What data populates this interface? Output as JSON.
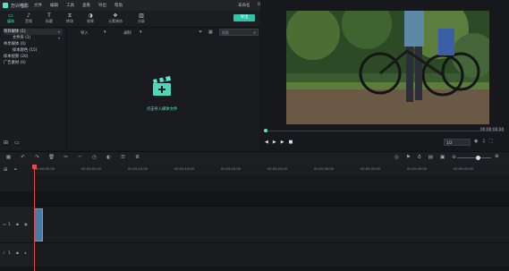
{
  "app": {
    "name": "万兴喵影",
    "project_name": "未命名",
    "timecode": "00:00:00:00"
  },
  "menu": [
    "文件",
    "编辑",
    "工具",
    "查看",
    "导出",
    "帮助"
  ],
  "toolbar": {
    "tabs": [
      {
        "label": "媒体",
        "icon": "folder-icon"
      },
      {
        "label": "音频",
        "icon": "music-icon"
      },
      {
        "label": "标题",
        "icon": "text-icon"
      },
      {
        "label": "转场",
        "icon": "transition-icon"
      },
      {
        "label": "效果",
        "icon": "effects-icon"
      },
      {
        "label": "元素装饰",
        "icon": "elements-icon"
      },
      {
        "label": "分屏",
        "icon": "split-screen-icon"
      }
    ],
    "export_label": "导出"
  },
  "left_panel": {
    "items": [
      {
        "label": "项目媒体 (1)",
        "selected": true
      },
      {
        "label": "文件夹 (1)",
        "selected": false
      },
      {
        "label": "共享媒体 (0)",
        "selected": false
      },
      {
        "label": "样本颜色 (15)",
        "selected": false
      },
      {
        "label": "样本视频 (20)",
        "selected": false
      },
      {
        "label": "广告素材 (0)",
        "selected": false
      }
    ]
  },
  "media_panel": {
    "import_label": "导入",
    "record_label": "录制",
    "search_placeholder": "搜索",
    "import_hint": "点击导入媒体文件"
  },
  "preview": {
    "current_time": "00:00:00:00",
    "quality": "1/2",
    "progress": 0
  },
  "timeline": {
    "ruler_ticks": [
      "00:00:00:00",
      "00:00:05:00",
      "00:00:10:00",
      "00:00:15:00",
      "00:00:20:00",
      "00:00:25:00",
      "00:00:30:00",
      "00:00:35:00",
      "00:00:40:00",
      "00:00:45:00"
    ],
    "tracks": [
      {
        "label": "1",
        "type": "video"
      },
      {
        "label": "1",
        "type": "audio"
      }
    ]
  },
  "colors": {
    "accent": "#56e5c9",
    "export_button": "#2ec4a5",
    "playhead": "#e04b4b",
    "clip": "#4a7aa8"
  }
}
